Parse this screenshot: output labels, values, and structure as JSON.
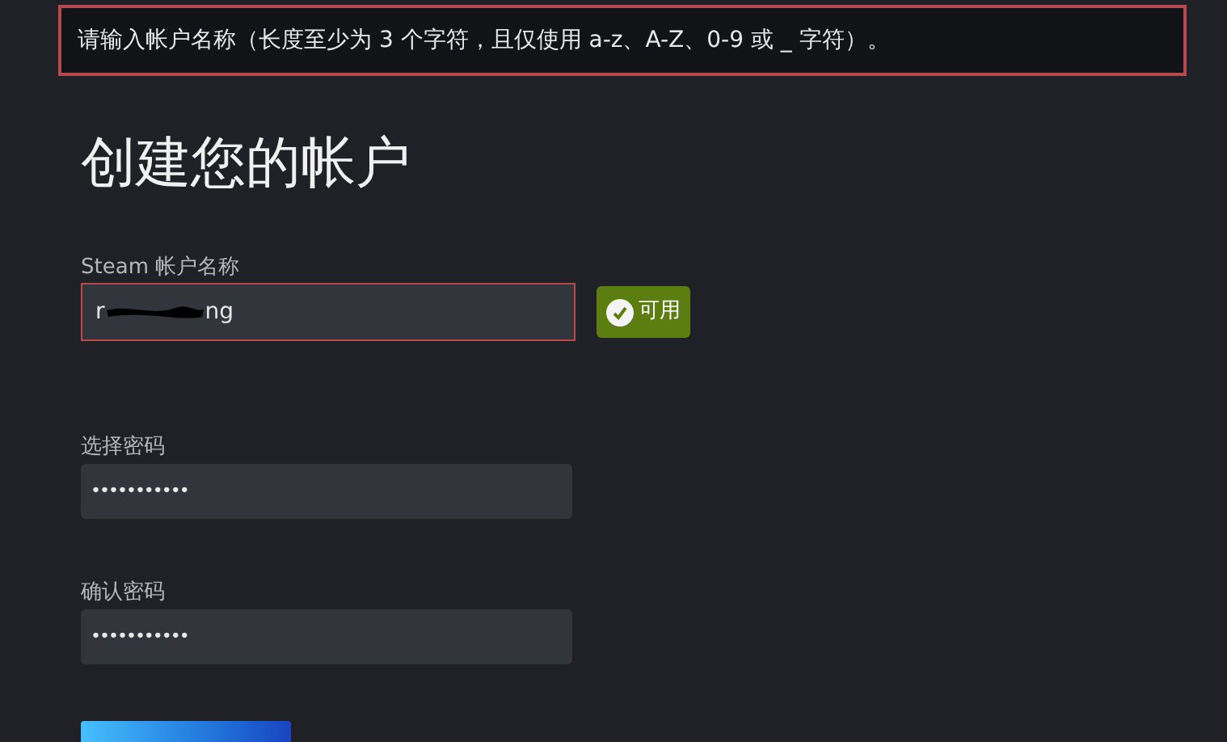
{
  "error_banner": {
    "text": "请输入帐户名称（长度至少为 3 个字符，且仅使用 a-z、A-Z、0-9 或 _ 字符）。"
  },
  "heading": "创建您的帐户",
  "account_name": {
    "label": "Steam 帐户名称",
    "value_start": "r",
    "value_end": "ng",
    "invalid": true,
    "status": {
      "text": "可用",
      "available": true
    }
  },
  "password_fields": [
    {
      "label": "选择密码",
      "value": "•••••••••••"
    },
    {
      "label": "确认密码",
      "value": "•••••••••••"
    }
  ],
  "submit_button": {
    "kind": "primary"
  }
}
